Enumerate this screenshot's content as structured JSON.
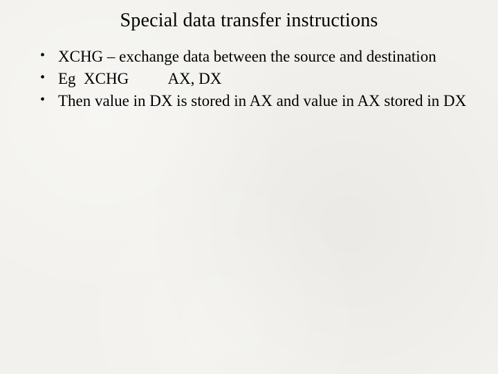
{
  "title": "Special data transfer instructions",
  "bullets": [
    "XCHG – exchange data between the source and destination",
    "Eg  XCHG          AX, DX",
    "Then value in DX is stored in AX and value in AX stored in DX"
  ]
}
